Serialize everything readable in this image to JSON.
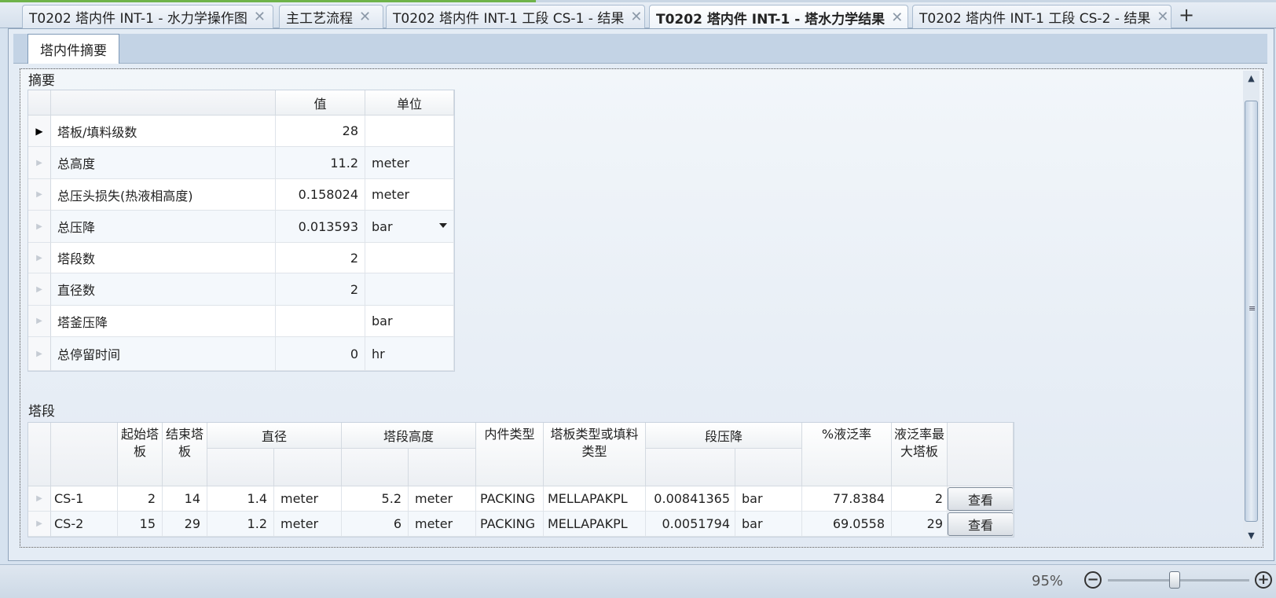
{
  "doc_tabs": [
    {
      "label": "T0202 塔内件 INT-1 - 水力学操作图"
    },
    {
      "label": "主工艺流程"
    },
    {
      "label": "T0202 塔内件 INT-1 工段 CS-1 - 结果"
    },
    {
      "label": "T0202 塔内件 INT-1 - 塔水力学结果"
    },
    {
      "label": "T0202 塔内件 INT-1 工段 CS-2 - 结果"
    }
  ],
  "close_glyph": "✕",
  "new_tab_glyph": "+",
  "inner_tab": "塔内件摘要",
  "summary": {
    "label": "摘要",
    "headers": {
      "value": "值",
      "unit": "单位"
    },
    "rows": [
      {
        "name": "塔板/填料级数",
        "value": "28",
        "unit": ""
      },
      {
        "name": "总高度",
        "value": "11.2",
        "unit": "meter"
      },
      {
        "name": "总压头损失(热液相高度)",
        "value": "0.158024",
        "unit": "meter"
      },
      {
        "name": "总压降",
        "value": "0.013593",
        "unit": "bar"
      },
      {
        "name": "塔段数",
        "value": "2",
        "unit": ""
      },
      {
        "name": "直径数",
        "value": "2",
        "unit": ""
      },
      {
        "name": "塔釜压降",
        "value": "",
        "unit": "bar"
      },
      {
        "name": "总停留时间",
        "value": "0",
        "unit": "hr"
      }
    ]
  },
  "sections": {
    "label": "塔段",
    "headers": {
      "start_tray": "起始塔板",
      "end_tray": "结束塔板",
      "diameter": "直径",
      "section_height": "塔段高度",
      "internal_type": "内件类型",
      "tray_or_packing_type": "塔板类型或填料类型",
      "section_dp": "段压降",
      "pct_flood": "%液泛率",
      "max_flood_tray": "液泛率最大塔板"
    },
    "rows": [
      {
        "name": "CS-1",
        "start": "2",
        "end": "14",
        "diameter": "1.4",
        "diameter_unit": "meter",
        "height": "5.2",
        "height_unit": "meter",
        "internal_type": "PACKING",
        "packing_type": "MELLAPAKPL",
        "dp": "0.00841365",
        "dp_unit": "bar",
        "flood": "77.8384",
        "max_tray": "2",
        "view_label": "查看"
      },
      {
        "name": "CS-2",
        "start": "15",
        "end": "29",
        "diameter": "1.2",
        "diameter_unit": "meter",
        "height": "6",
        "height_unit": "meter",
        "internal_type": "PACKING",
        "packing_type": "MELLAPAKPL",
        "dp": "0.0051794",
        "dp_unit": "bar",
        "flood": "69.0558",
        "max_tray": "29",
        "view_label": "查看"
      }
    ]
  },
  "statusbar": {
    "zoom_label": "95%",
    "zoom_value": 0.47,
    "zoom_out_glyph": "−",
    "zoom_in_glyph": "+"
  }
}
